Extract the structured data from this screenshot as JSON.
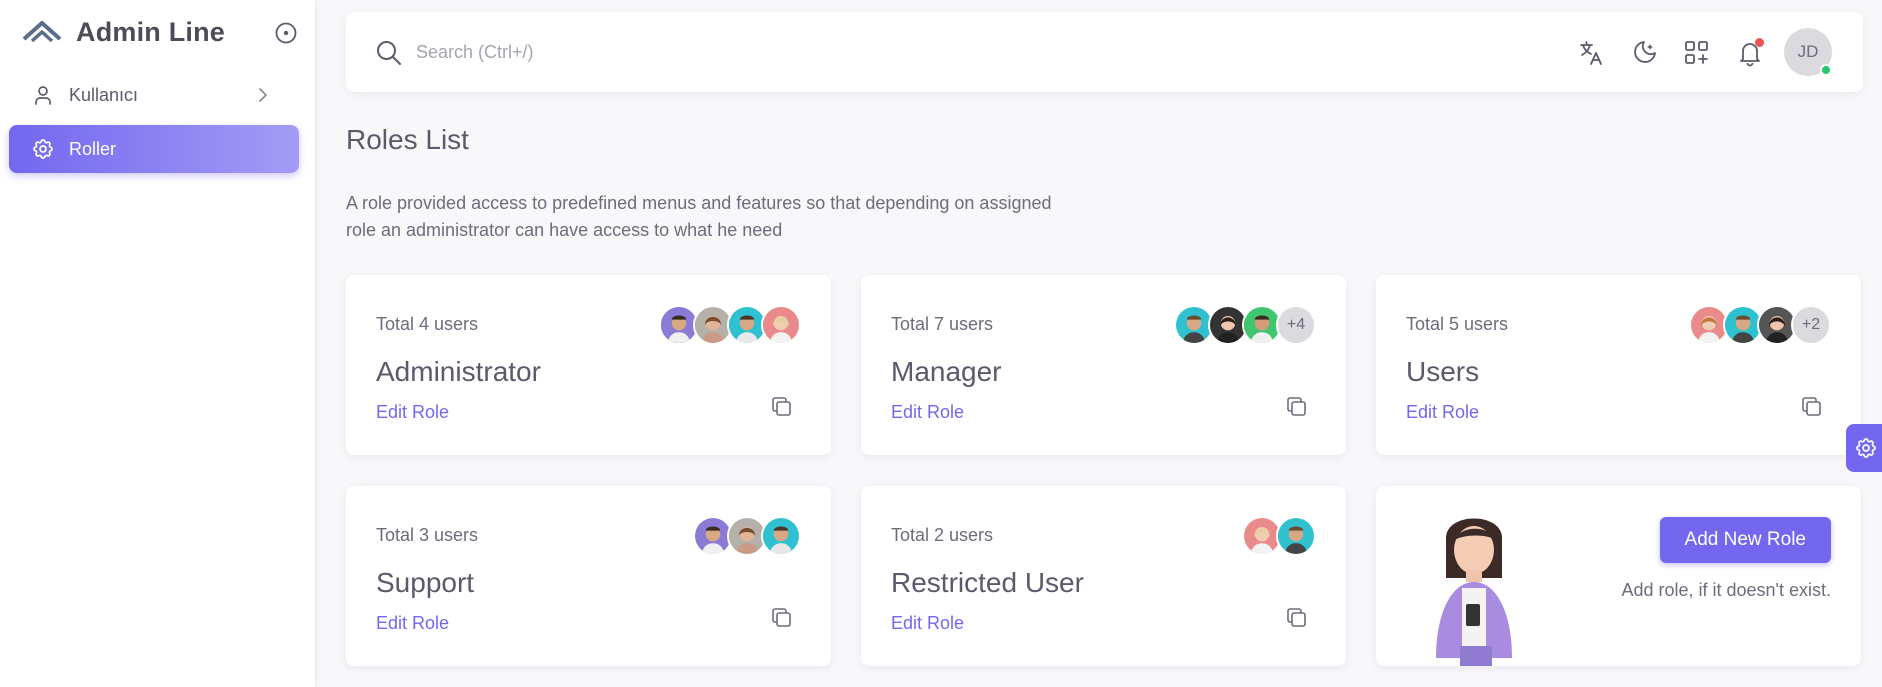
{
  "app": {
    "name": "Admin Line"
  },
  "sidebar": {
    "items": [
      {
        "label": "Kullanıcı",
        "icon": "user-icon"
      },
      {
        "label": "Roller",
        "icon": "gear-icon",
        "active": true
      }
    ]
  },
  "search": {
    "placeholder": "Search (Ctrl+/)"
  },
  "user": {
    "initials": "JD",
    "status": "online"
  },
  "page": {
    "title": "Roles List",
    "description": "A role provided access to predefined menus and features so that depending on assigned role an administrator can have access to what he need"
  },
  "roles": [
    {
      "total": "Total 4 users",
      "name": "Administrator",
      "edit": "Edit Role",
      "extra": ""
    },
    {
      "total": "Total 7 users",
      "name": "Manager",
      "edit": "Edit Role",
      "extra": "+4"
    },
    {
      "total": "Total 5 users",
      "name": "Users",
      "edit": "Edit Role",
      "extra": "+2"
    },
    {
      "total": "Total 3 users",
      "name": "Support",
      "edit": "Edit Role",
      "extra": ""
    },
    {
      "total": "Total 2 users",
      "name": "Restricted User",
      "edit": "Edit Role",
      "extra": ""
    }
  ],
  "add_role": {
    "button": "Add New Role",
    "hint": "Add role, if it doesn't exist."
  },
  "colors": {
    "primary": "#7367f0",
    "notification": "#ea5455",
    "online": "#28c76f"
  }
}
